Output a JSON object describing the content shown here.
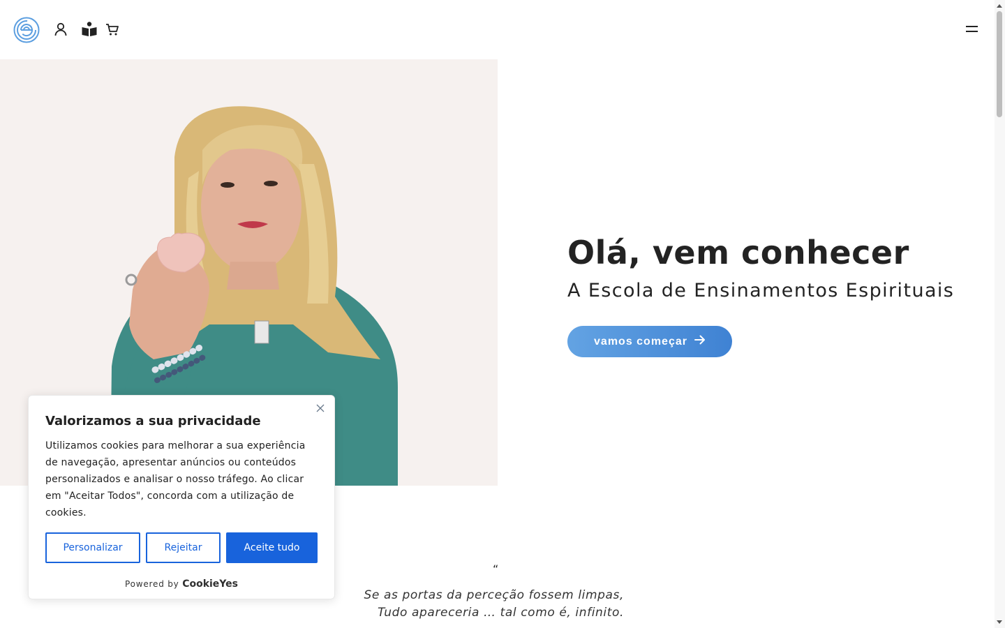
{
  "header": {
    "logo_icon": "circular-e-logo-icon",
    "icons": [
      "user-icon",
      "reading-book-icon",
      "cart-icon"
    ],
    "menu_icon": "hamburger-menu-icon"
  },
  "hero": {
    "image_icon": "woman-holding-heart-crystal-photo",
    "title": "Olá, vem conhecer",
    "subtitle": "A Escola de Ensinamentos Espirituais",
    "cta_label": "vamos começar",
    "cta_icon": "arrow-right-icon",
    "accent_color": "#4a8fdc",
    "image_bg": "#f6f1ef"
  },
  "quote": {
    "mark": "“",
    "lines": [
      "Se as portas da perceção fossem limpas,",
      "Tudo apareceria … tal como é, infinito."
    ]
  },
  "cookie_banner": {
    "title": "Valorizamos a sua privacidade",
    "text": "Utilizamos cookies para melhorar a sua experiência de navegação, apresentar anúncios ou conteúdos personalizados e analisar o nosso tráfego. Ao clicar em \"Aceitar Todos\", concorda com a utilização de cookies.",
    "buttons": {
      "customize": "Personalizar",
      "reject": "Rejeitar",
      "accept": "Aceite tudo"
    },
    "powered_by": "Powered by",
    "brand": "CookieYes",
    "brand_color": "#1863dc"
  }
}
